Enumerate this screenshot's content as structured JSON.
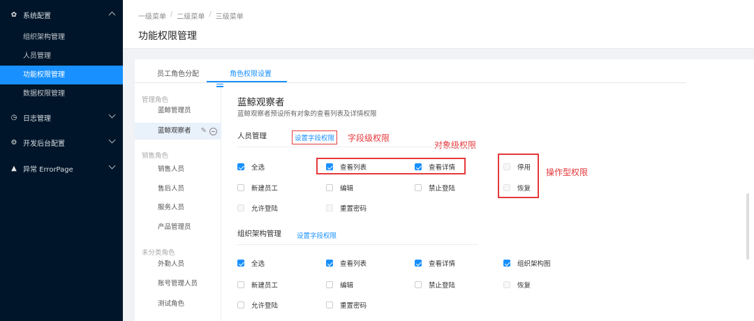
{
  "sidebar": {
    "groups": [
      {
        "label": "系统配置",
        "icon": "gear-icon",
        "expanded": true
      },
      {
        "label": "日志管理",
        "icon": "clock-icon",
        "expanded": false
      },
      {
        "label": "开发后台配置",
        "icon": "settings-icon",
        "expanded": false
      },
      {
        "label": "异常 ErrorPage",
        "icon": "warning-icon",
        "expanded": false
      }
    ],
    "items": [
      "组织架构管理",
      "人员管理",
      "功能权限管理",
      "数据权限管理"
    ],
    "active_item": "功能权限管理"
  },
  "breadcrumb": [
    "一级菜单",
    "二级菜单",
    "三级菜单"
  ],
  "page_title": "功能权限管理",
  "tabs": [
    {
      "label": "员工角色分配",
      "active": false
    },
    {
      "label": "角色权限设置",
      "active": true
    }
  ],
  "roles": {
    "groups": [
      {
        "label": "管理角色",
        "items": [
          "蓝鲸管理员",
          "蓝鲸观察者"
        ]
      },
      {
        "label": "销售角色",
        "items": [
          "销售人员",
          "售后人员",
          "服务人员",
          "产品管理员"
        ]
      },
      {
        "label": "未分类角色",
        "items": [
          "外勤人员",
          "账号管理人员",
          "测试角色"
        ]
      }
    ],
    "active": "蓝鲸观察者"
  },
  "detail": {
    "title": "蓝鲸观察者",
    "description": "蓝鲸观察者预设所有对象的查看列表及详情权限",
    "sections": [
      {
        "title": "人员管理",
        "link": "设置字段权限",
        "rows": [
          [
            {
              "label": "全选",
              "checked": true
            },
            {
              "label": "查看列表",
              "checked": true
            },
            {
              "label": "查看详情",
              "checked": true
            },
            {
              "label": "停用",
              "checked": false
            }
          ],
          [
            {
              "label": "新建员工",
              "checked": false
            },
            {
              "label": "编辑",
              "checked": false
            },
            {
              "label": "禁止登陆",
              "checked": false
            },
            {
              "label": "恢复",
              "checked": false
            }
          ],
          [
            {
              "label": "允许登陆",
              "checked": false
            },
            {
              "label": "重置密码",
              "checked": false
            }
          ]
        ]
      },
      {
        "title": "组织架构管理",
        "link": "设置字段权限",
        "rows": [
          [
            {
              "label": "全选",
              "checked": true
            },
            {
              "label": "查看列表",
              "checked": true
            },
            {
              "label": "查看详情",
              "checked": true
            },
            {
              "label": "组织架构图",
              "checked": true
            }
          ],
          [
            {
              "label": "新建员工",
              "checked": false
            },
            {
              "label": "编辑",
              "checked": false
            },
            {
              "label": "禁止登陆",
              "checked": false
            },
            {
              "label": "恢复",
              "checked": false
            }
          ],
          [
            {
              "label": "允许登陆",
              "checked": false
            },
            {
              "label": "重置密码",
              "checked": false
            }
          ]
        ]
      }
    ]
  },
  "annotations": {
    "field": "字段级权限",
    "object": "对象级权限",
    "operation": "操作型权限"
  },
  "colors": {
    "sidebar_bg": "#001529",
    "primary": "#1890ff",
    "annotation": "#e5383b"
  }
}
